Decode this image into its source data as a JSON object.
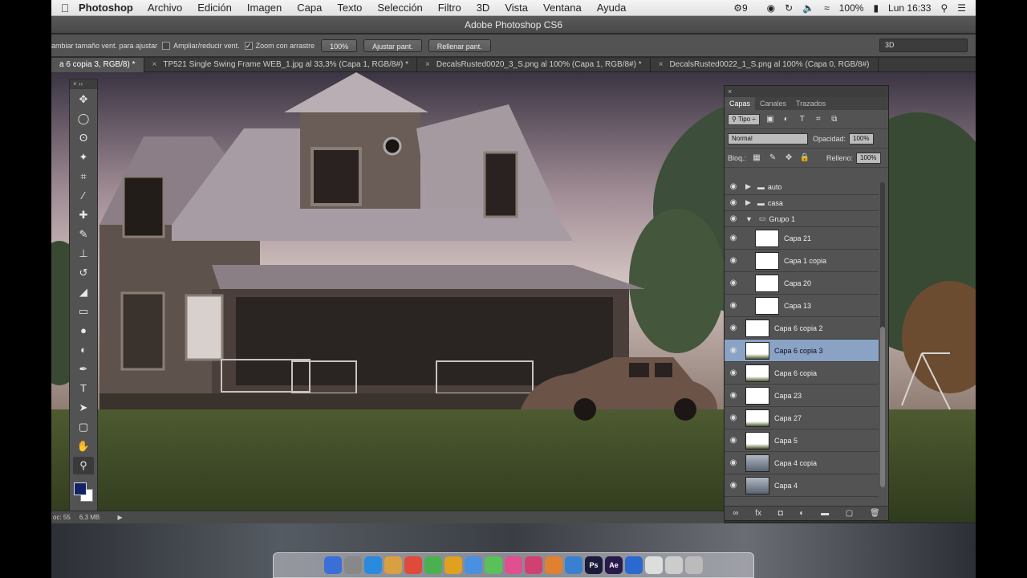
{
  "menubar": {
    "app_name": "Photoshop",
    "items": [
      "Archivo",
      "Edición",
      "Imagen",
      "Capa",
      "Texto",
      "Selección",
      "Filtro",
      "3D",
      "Vista",
      "Ventana",
      "Ayuda"
    ],
    "status": {
      "notification_count": "9",
      "battery": "100%",
      "clock": "Lun 16:33"
    }
  },
  "window": {
    "title": "Adobe Photoshop CS6"
  },
  "options_bar": {
    "resize_label": "ambiar tamaño vent. para ajustar",
    "zoom_all_label": "Ampliar/reducir vent.",
    "scrubby_zoom_label": "Zoom con arrastre",
    "zoom_value": "100%",
    "fit_button": "Ajustar pant.",
    "fill_button": "Rellenar pant.",
    "workspace": "3D"
  },
  "tabs": [
    {
      "label": "a 6 copia 3, RGB/8) *"
    },
    {
      "label": "TP521 Single Swing Frame WEB_1.jpg al 33,3% (Capa 1, RGB/8#) *"
    },
    {
      "label": "DecalsRusted0020_3_S.png al 100% (Capa 1, RGB/8#) *"
    },
    {
      "label": "DecalsRusted0022_1_S.png al 100% (Capa 0, RGB/8#)"
    }
  ],
  "statusbar": {
    "doc_label": "oc: 55",
    "doc_size": "6,3 MB"
  },
  "layers_panel": {
    "tabs": [
      "Capas",
      "Canales",
      "Trazados"
    ],
    "kind_filter": "Tipo",
    "blend_mode": "Normal",
    "opacity_label": "Opacidad:",
    "opacity_value": "100%",
    "lock_label": "Bloq.:",
    "fill_label": "Relleno:",
    "fill_value": "100%",
    "layers": [
      {
        "name": "auto",
        "type": "group"
      },
      {
        "name": "casa",
        "type": "group"
      },
      {
        "name": "Grupo 1",
        "type": "group-open"
      },
      {
        "name": "Capa 21",
        "type": "layer"
      },
      {
        "name": "Capa 1 copia",
        "type": "layer"
      },
      {
        "name": "Capa 20",
        "type": "layer"
      },
      {
        "name": "Capa 13",
        "type": "layer"
      },
      {
        "name": "Capa 6 copia 2",
        "type": "layer"
      },
      {
        "name": "Capa 6 copia 3",
        "type": "layer",
        "selected": true
      },
      {
        "name": "Capa 6 copia",
        "type": "layer"
      },
      {
        "name": "Capa 23",
        "type": "layer"
      },
      {
        "name": "Capa 27",
        "type": "layer"
      },
      {
        "name": "Capa 5",
        "type": "layer"
      },
      {
        "name": "Capa 4 copia",
        "type": "layer"
      },
      {
        "name": "Capa 4",
        "type": "layer"
      }
    ]
  },
  "colors": {
    "foreground": "#112266",
    "background": "#ffffff",
    "selection": "#8aa2c4"
  }
}
